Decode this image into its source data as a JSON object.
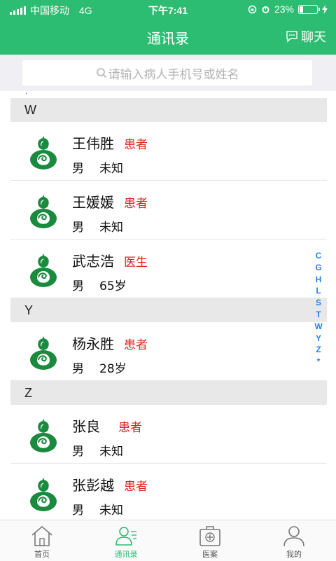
{
  "status_bar": {
    "carrier": "中国移动",
    "network": "4G",
    "time": "下午7:41",
    "battery": "23%",
    "battery_level": 0.23
  },
  "nav": {
    "title": "通讯录",
    "chat_label": "聊天"
  },
  "search": {
    "placeholder": "请输入病人手机号或姓名"
  },
  "list": {
    "dot": ".",
    "sections": [
      {
        "letter": "W",
        "contacts": [
          {
            "name": "王伟胜",
            "role": "患者",
            "gender": "男",
            "age": "未知"
          },
          {
            "name": "王媛媛",
            "role": "患者",
            "gender": "男",
            "age": "未知"
          },
          {
            "name": "武志浩",
            "role": "医生",
            "gender": "男",
            "age": "65岁"
          }
        ]
      },
      {
        "letter": "Y",
        "contacts": [
          {
            "name": "杨永胜",
            "role": "患者",
            "gender": "男",
            "age": "28岁"
          }
        ]
      },
      {
        "letter": "Z",
        "contacts": [
          {
            "name": "张良",
            "role": "患者",
            "gender": "男",
            "age": "未知"
          },
          {
            "name": "张彭越",
            "role": "患者",
            "gender": "男",
            "age": "未知"
          }
        ]
      }
    ]
  },
  "index_letters": [
    "C",
    "G",
    "H",
    "L",
    "S",
    "T",
    "W",
    "Y",
    "Z",
    "*"
  ],
  "tabs": [
    {
      "label": "首页",
      "icon": "home-icon"
    },
    {
      "label": "通讯录",
      "icon": "contacts-icon"
    },
    {
      "label": "医案",
      "icon": "medical-case-icon"
    },
    {
      "label": "我的",
      "icon": "profile-icon"
    }
  ],
  "colors": {
    "brand_green": "#2dbd72",
    "role_red": "#e02424",
    "index_blue": "#1e84f0"
  }
}
